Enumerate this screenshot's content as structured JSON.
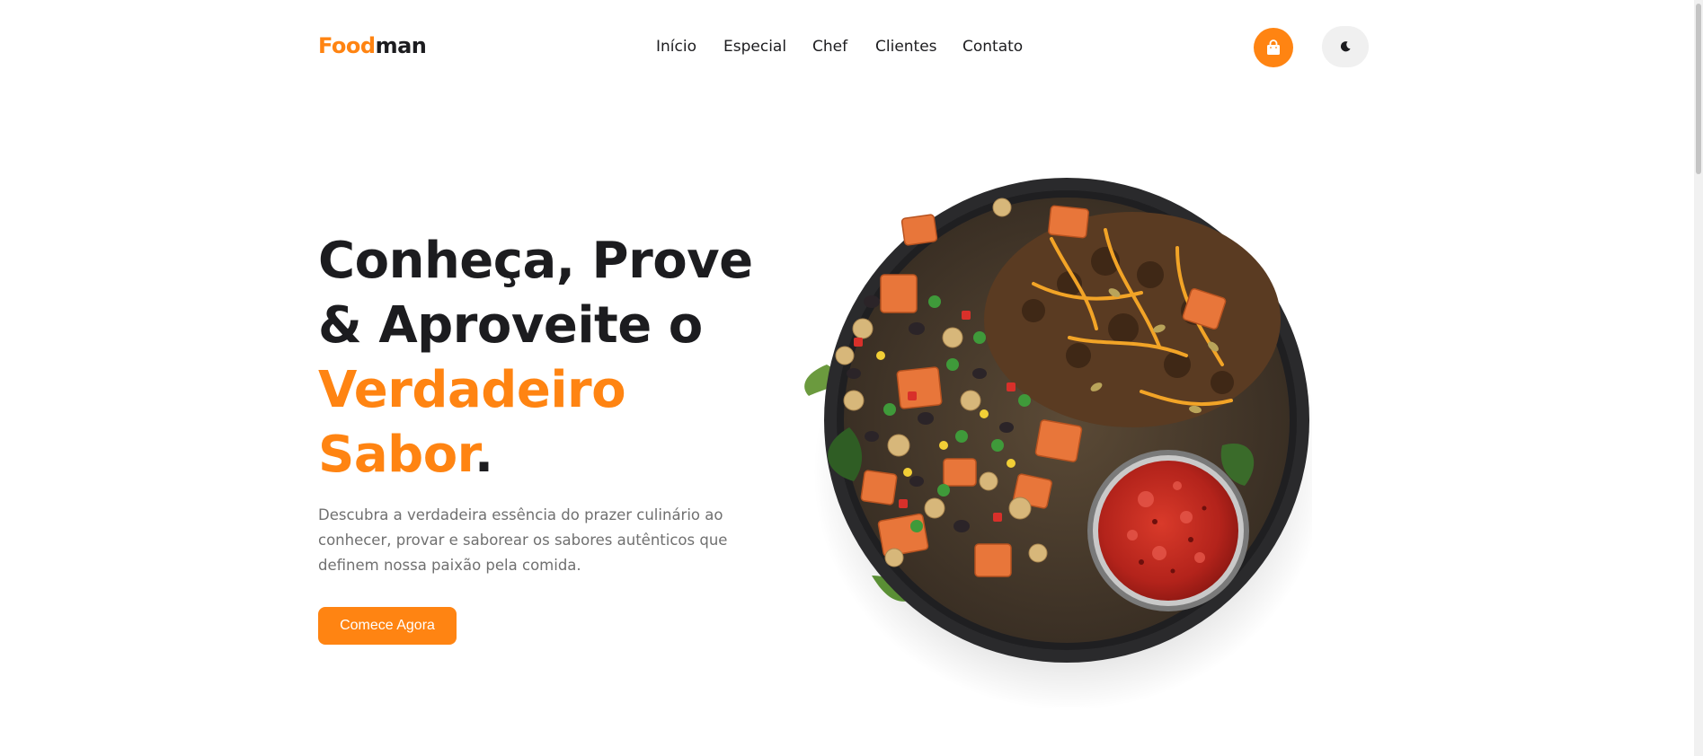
{
  "brand": {
    "part1": "Food",
    "part2": "man"
  },
  "nav": {
    "items": [
      {
        "id": "inicio",
        "label": "Início"
      },
      {
        "id": "especial",
        "label": "Especial"
      },
      {
        "id": "chef",
        "label": "Chef"
      },
      {
        "id": "clientes",
        "label": "Clientes"
      },
      {
        "id": "contato",
        "label": "Contato"
      }
    ]
  },
  "header": {
    "cart_icon": "shopping-bag-icon",
    "theme_icon": "moon-icon"
  },
  "hero": {
    "title_line1": "Conheça, Prove",
    "title_line2": "& Aproveite o",
    "title_accent1": "Verdadeiro",
    "title_accent2": "Sabor",
    "title_dot": ".",
    "description": "Descubra a verdadeira essência do prazer culinário ao conhecer, provar e saborear os sabores autênticos que definem nossa paixão pela comida.",
    "cta_label": "Comece Agora"
  },
  "colors": {
    "accent": "#ff8412",
    "text": "#1c1c1f",
    "muted": "#707070",
    "bowl": "#2a2a2c"
  }
}
